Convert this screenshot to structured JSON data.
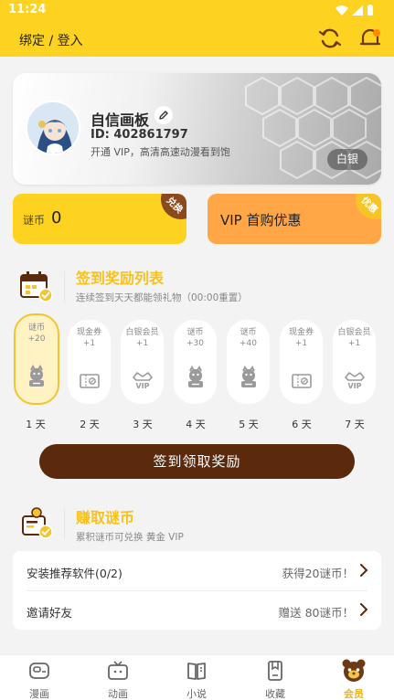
{
  "status_bar": {
    "time": "11:24"
  },
  "header": {
    "title": "绑定 / 登入"
  },
  "profile": {
    "nickname": "自信画板",
    "uid": "ID: 402861797",
    "vip_promo": "开通 VIP，高清高速动漫看到饱",
    "level_badge": "白银"
  },
  "coin_card": {
    "label": "谜币",
    "value": "0",
    "corner_label": "兑换",
    "corner_color": "#8b4a1d"
  },
  "vip_card": {
    "label": "VIP 首购优惠",
    "corner_label": "优惠",
    "corner_color": "#f7c428"
  },
  "signin": {
    "title": "签到奖励列表",
    "subtitle": "连续签到天天都能领礼物（00:00重置）",
    "days": [
      {
        "name": "谜币",
        "amount": "+20",
        "day_label": "1 天",
        "icon": "coin-mascot-icon"
      },
      {
        "name": "现金券",
        "amount": "+1",
        "day_label": "2 天",
        "icon": "cash-coupon-icon"
      },
      {
        "name": "白银会员",
        "amount": "+1",
        "day_label": "3 天",
        "icon": "vip-crown-icon"
      },
      {
        "name": "谜币",
        "amount": "+30",
        "day_label": "4 天",
        "icon": "coin-mascot-icon"
      },
      {
        "name": "谜币",
        "amount": "+40",
        "day_label": "5 天",
        "icon": "coin-mascot-icon"
      },
      {
        "name": "现金券",
        "amount": "+1",
        "day_label": "6 天",
        "icon": "cash-coupon-icon"
      },
      {
        "name": "白银会员",
        "amount": "+1",
        "day_label": "7 天",
        "icon": "vip-crown-icon"
      }
    ],
    "button_label": "签到领取奖励"
  },
  "earn": {
    "title": "赚取谜币",
    "subtitle": "累积谜币可兑换 黄金 VIP",
    "tasks": [
      {
        "label": "安装推荐软件(0/2)",
        "reward": "获得20谜币！"
      },
      {
        "label": "邀请好友",
        "reward": "赠送 80谜币！"
      }
    ]
  },
  "bottom_nav": [
    {
      "label": "漫画",
      "icon": "comic-icon"
    },
    {
      "label": "动画",
      "icon": "tv-icon"
    },
    {
      "label": "小说",
      "icon": "book-icon"
    },
    {
      "label": "收藏",
      "icon": "bookmark-icon"
    },
    {
      "label": "会员",
      "icon": "bear-member-icon"
    }
  ],
  "colors": {
    "accent": "#fed221",
    "active_nav": "#f3ae12",
    "button": "#5b2a0c",
    "title_yellow": "#f6c21e"
  }
}
